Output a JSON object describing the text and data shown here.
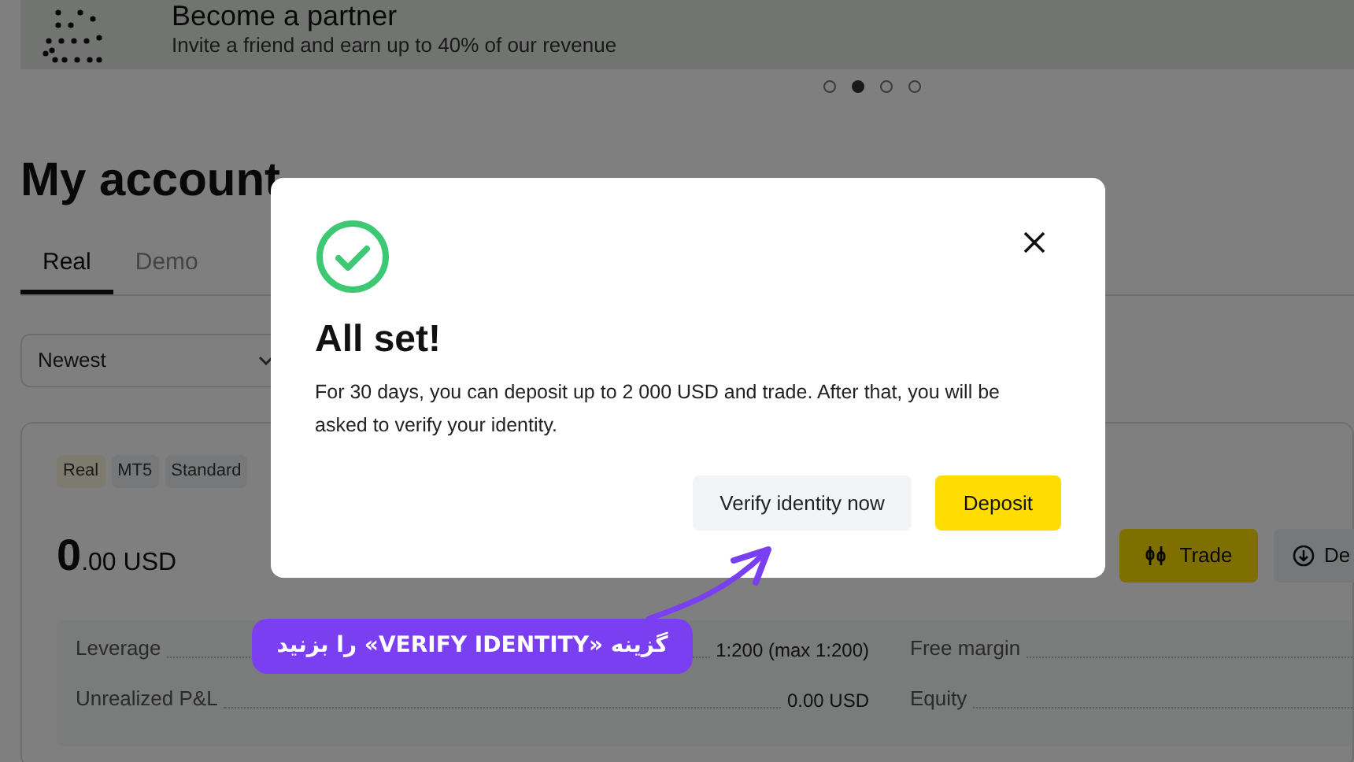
{
  "banner": {
    "title": "Become a partner",
    "subtitle": "Invite a friend and earn up to 40% of our revenue"
  },
  "carousel_dots": [
    {
      "selected": false
    },
    {
      "selected": true
    },
    {
      "selected": false
    },
    {
      "selected": false
    }
  ],
  "heading": "My account",
  "tabs": [
    {
      "label": "Real",
      "selected": true
    },
    {
      "label": "Demo",
      "selected": false
    }
  ],
  "sort": {
    "value": "Newest"
  },
  "account": {
    "tags": [
      {
        "label": "Real",
        "color": "#7d7b6e"
      },
      {
        "label": "MT5",
        "color": "#777879"
      },
      {
        "label": "Standard",
        "color": "#777879"
      }
    ],
    "balance": {
      "whole": "0",
      "fraction": ".00",
      "currency": "USD"
    },
    "actions": [
      {
        "label": "Trade",
        "kind": "trade"
      },
      {
        "label": "De",
        "kind": "deposit"
      }
    ],
    "stats_left": [
      {
        "label": "Leverage",
        "value": "1:200 (max 1:200)"
      },
      {
        "label": "Unrealized P&L",
        "value": "0.00 USD"
      }
    ],
    "stats_right": [
      {
        "label": "Free margin"
      },
      {
        "label": "Equity"
      }
    ]
  },
  "dialog": {
    "title": "All set!",
    "body": "For 30 days, you can deposit up to 2 000 USD and trade. After that, you will be asked to verify your identity.",
    "buttons": [
      {
        "label": "Verify identity now",
        "kind": "secondary"
      },
      {
        "label": "Deposit",
        "kind": "primary"
      }
    ]
  },
  "annotation": {
    "text": "گزینه «VERIFY IDENTITY» را بزنید"
  }
}
